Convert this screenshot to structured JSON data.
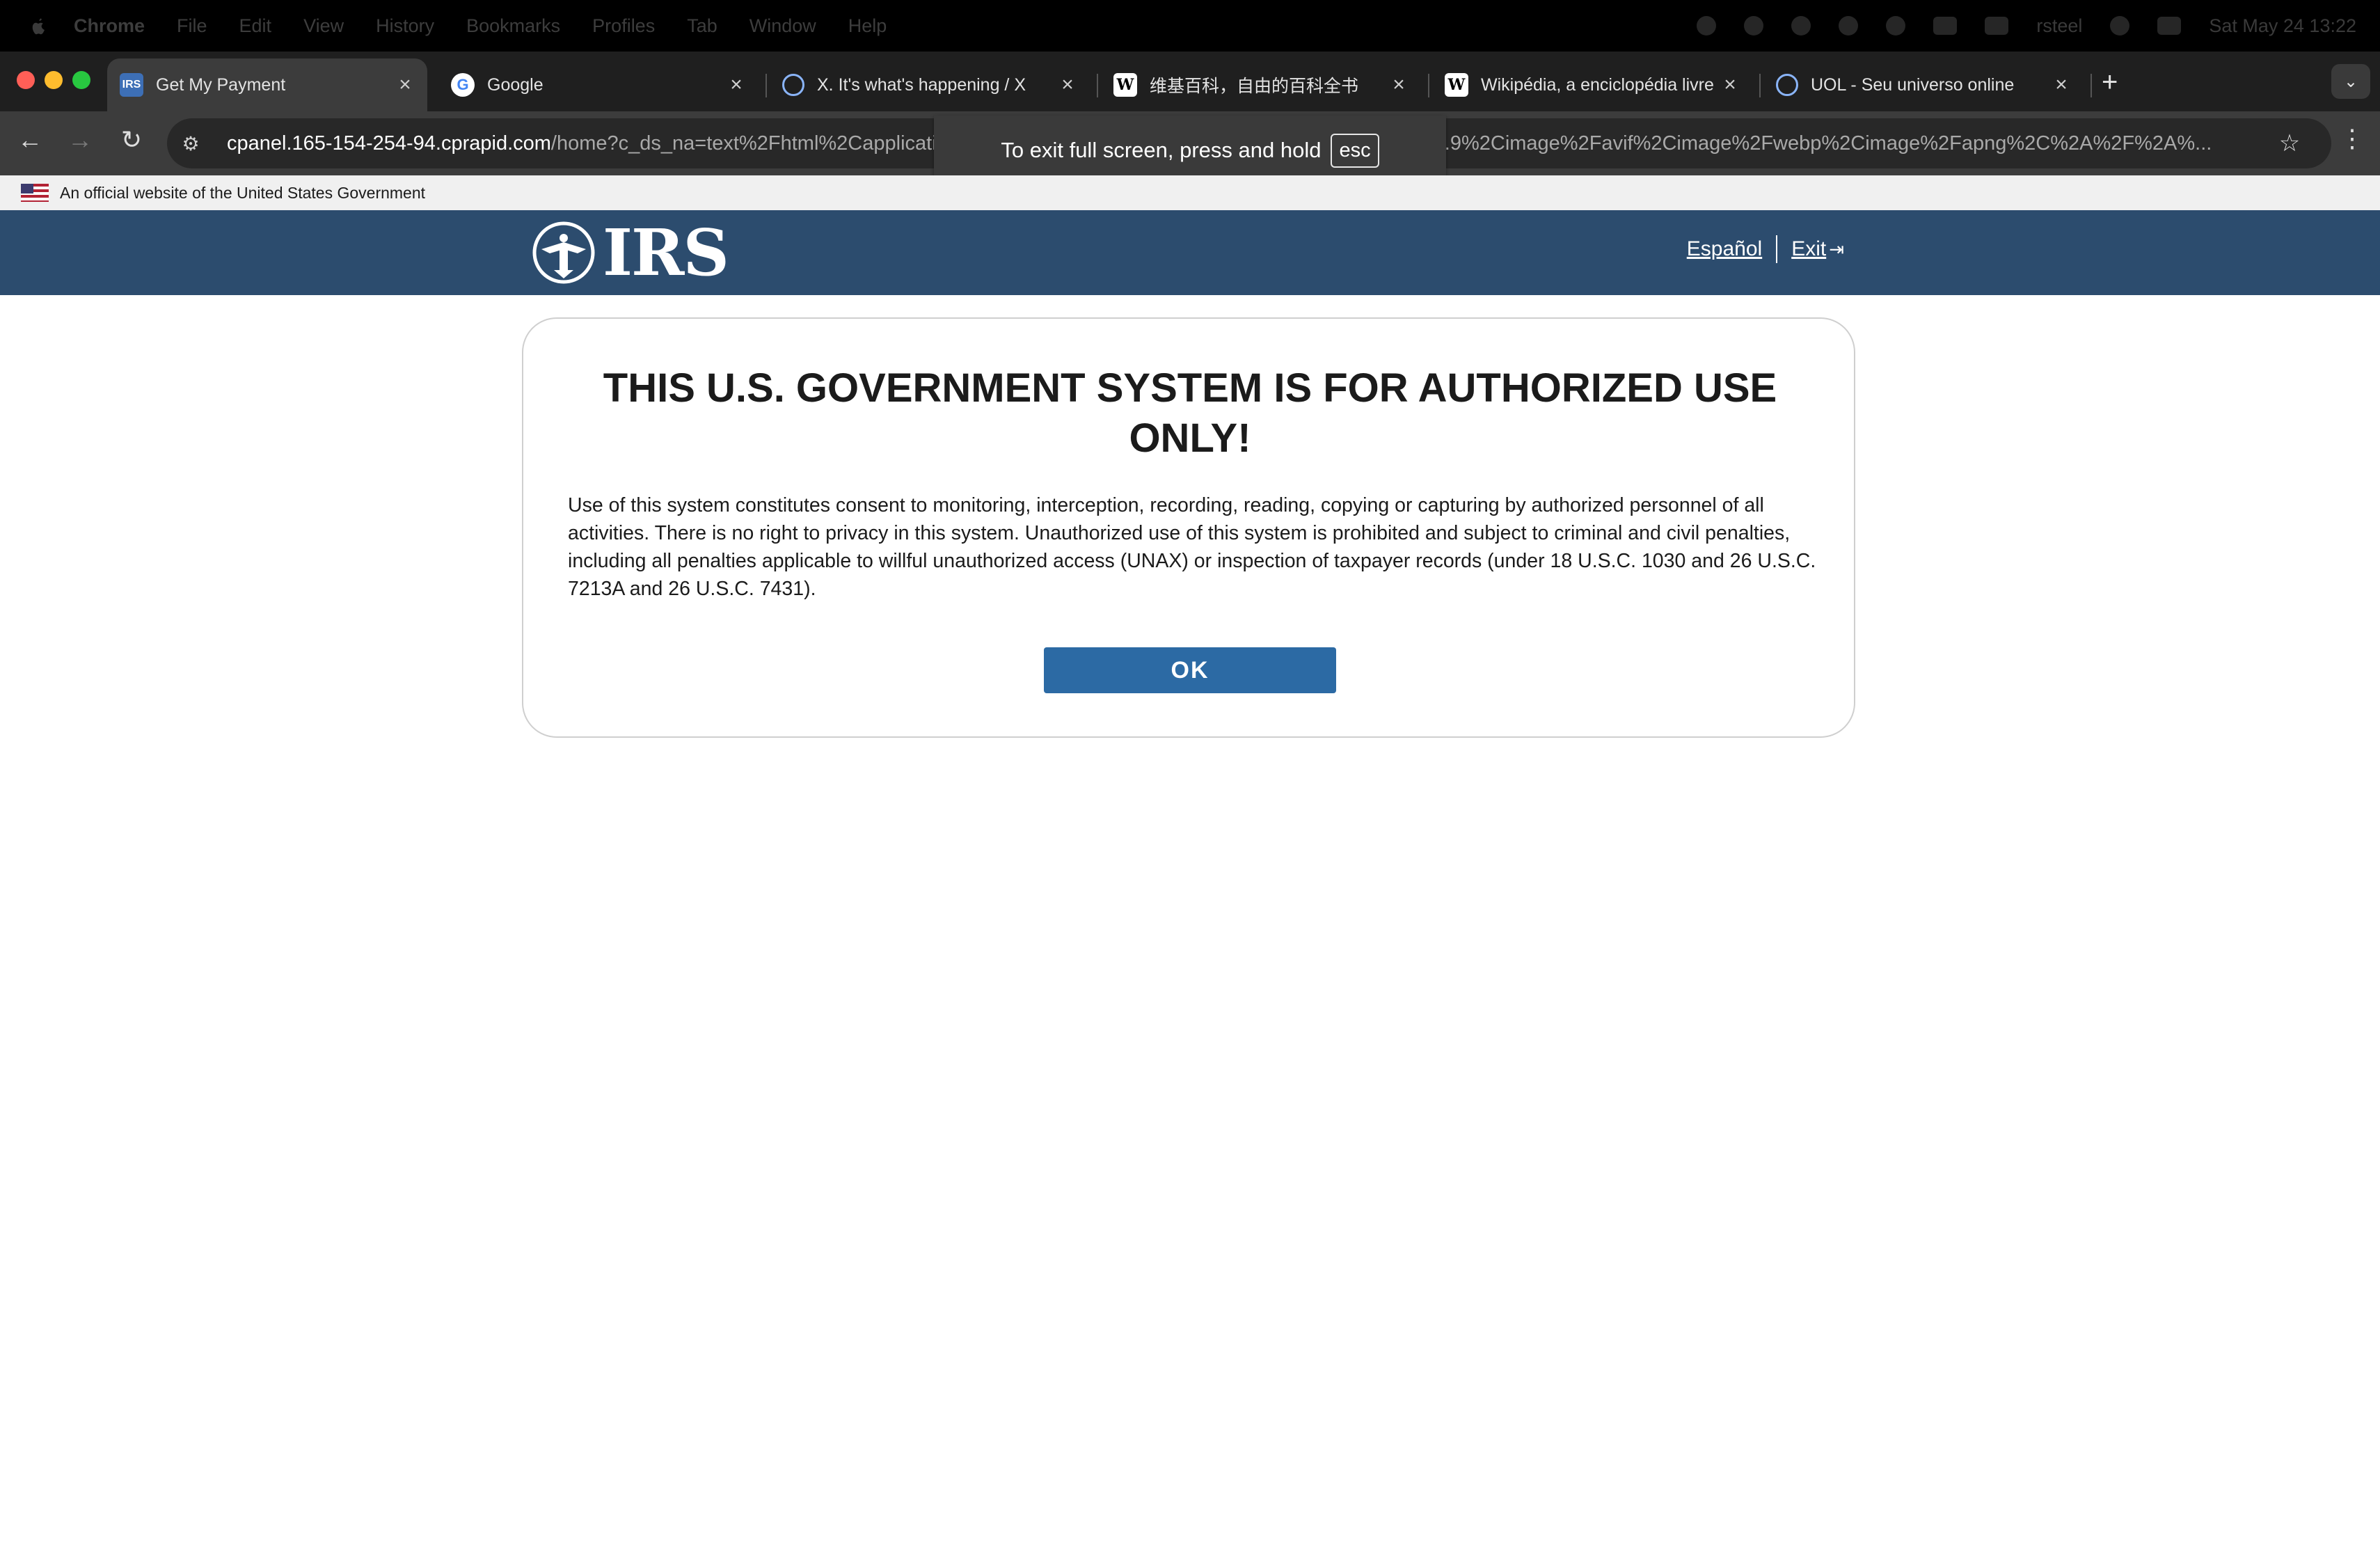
{
  "menubar": {
    "app": "Chrome",
    "items": [
      "File",
      "Edit",
      "View",
      "History",
      "Bookmarks",
      "Profiles",
      "Tab",
      "Window",
      "Help"
    ],
    "user": "rsteel",
    "clock": "Sat May 24  13:22"
  },
  "tabs": [
    {
      "title": "Get My Payment",
      "favicon": "irs-icon"
    },
    {
      "title": "Google",
      "favicon": "google-icon"
    },
    {
      "title": "X. It's what's happening / X",
      "favicon": "loading-icon"
    },
    {
      "title": "维基百科，自由的百科全书",
      "favicon": "wikipedia-icon"
    },
    {
      "title": "Wikipédia, a enciclopédia livre",
      "favicon": "wikipedia-icon"
    },
    {
      "title": "UOL - Seu universo online",
      "favicon": "loading-icon"
    }
  ],
  "address": {
    "host": "cpanel.165-154-254-94.cprapid.com",
    "path": "/home?c_ds_na=text%2Fhtml%2Capplication%2Fxhtml%2Bxml%2Capplication%2Fxml%3Bq%3D0.9%2Cimage%2Favif%2Cimage%2Fwebp%2Cimage%2Fapng%2C%2A%2F%2A%..."
  },
  "fullscreen_toast": {
    "text": "To exit full screen, press and hold",
    "key": "esc"
  },
  "gov_banner": {
    "text": "An official website of the United States Government"
  },
  "header": {
    "logo_text": "IRS",
    "lang_link": "Español",
    "exit_link": "Exit"
  },
  "notice": {
    "title": "THIS U.S. GOVERNMENT SYSTEM IS FOR AUTHORIZED USE ONLY!",
    "body": "Use of this system constitutes consent to monitoring, interception, recording, reading, copying or capturing by authorized personnel of all activities. There is no right to privacy in this system. Unauthorized use of this system is prohibited and subject to criminal and civil penalties, including all penalties applicable to willful unauthorized access (UNAX) or inspection of taxpayer records (under 18 U.S.C. 1030 and 26 U.S.C. 7213A and 26 U.S.C. 7431).",
    "ok_label": "OK"
  },
  "colors": {
    "irs_header": "#2c4c6e",
    "ok_button": "#2c6aa4",
    "close_light": "#ff5f57",
    "minimize_light": "#febc2e",
    "zoom_light": "#28c840"
  }
}
